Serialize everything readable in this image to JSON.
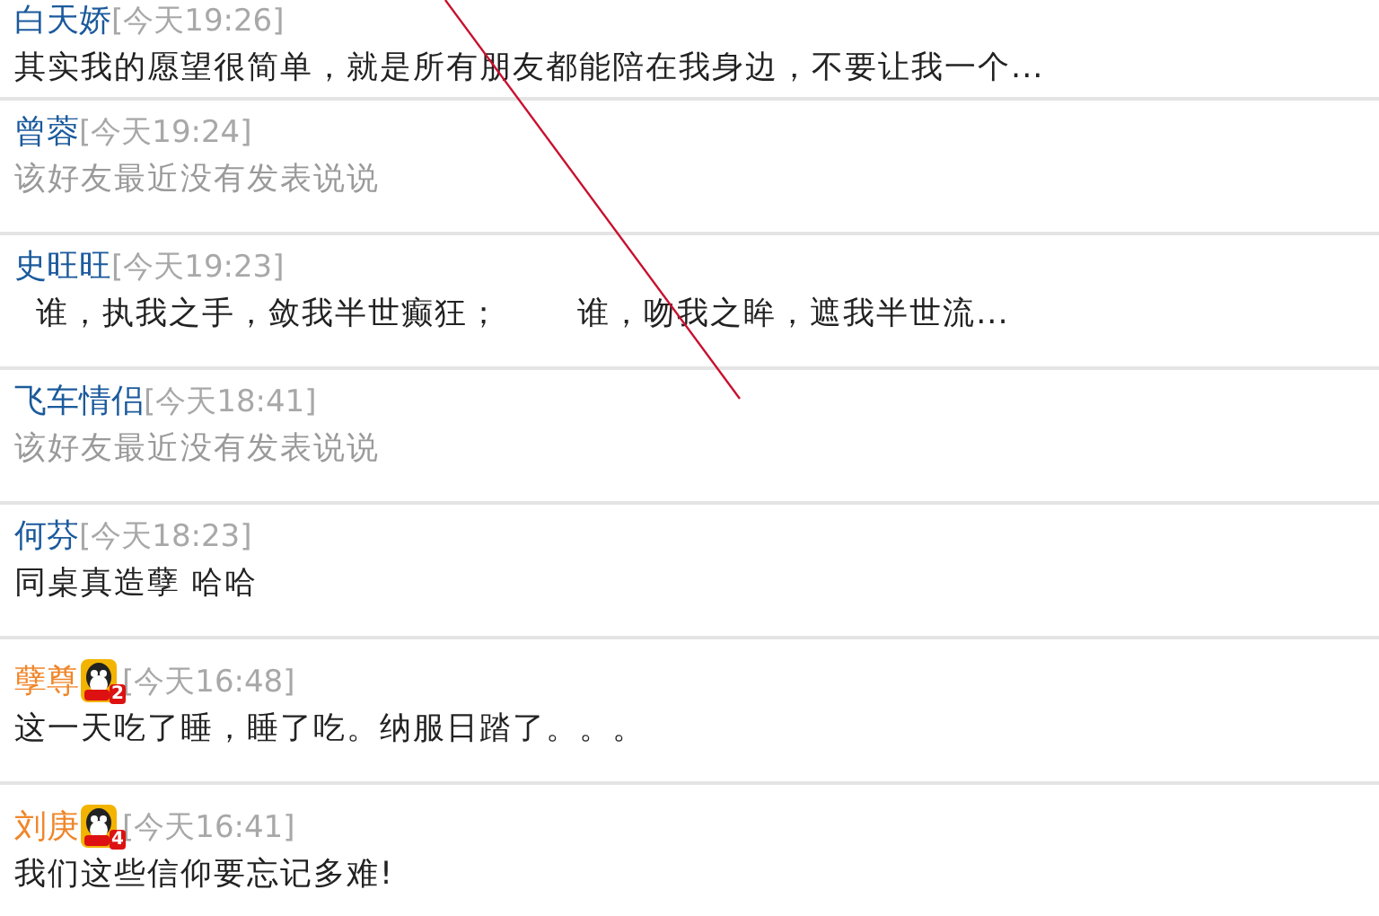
{
  "feeds": [
    {
      "name": "白天娇",
      "vip": false,
      "time": "[今天19:26]",
      "status": "其实我的愿望很简单，就是所有朋友都能陪在我身边，不要让我一个...",
      "kind": "post"
    },
    {
      "name": "曾蓉",
      "vip": false,
      "time": "[今天19:24]",
      "status": "该好友最近没有发表说说",
      "kind": "empty"
    },
    {
      "name": "史旺旺",
      "vip": false,
      "time": "[今天19:23]",
      "status": "  谁，执我之手，敛我半世癫狂；       谁，吻我之眸，遮我半世流...",
      "kind": "post"
    },
    {
      "name": "飞车情侣",
      "vip": false,
      "time": "[今天18:41]",
      "status": "该好友最近没有发表说说",
      "kind": "empty"
    },
    {
      "name": "何芬",
      "vip": false,
      "time": "[今天18:23]",
      "status": "同桌真造孽 哈哈",
      "kind": "post"
    },
    {
      "name": "孽尊",
      "vip": true,
      "vip_level": "2",
      "time": "[今天16:48]",
      "status": "这一天吃了睡，睡了吃。纳服日踏了。。。",
      "kind": "post"
    },
    {
      "name": "刘庚",
      "vip": true,
      "vip_level": "4",
      "time": "[今天16:41]",
      "status": "我们这些信仰要忘记多难!",
      "kind": "post"
    }
  ]
}
